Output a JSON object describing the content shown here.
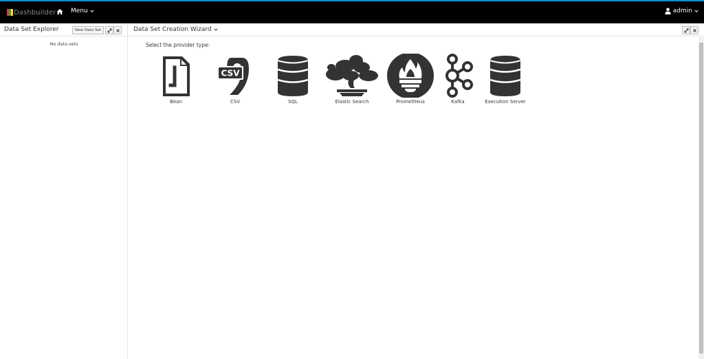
{
  "topbar": {
    "brand": "Dashbuilder",
    "menu_label": "Menu",
    "user_label": "admin",
    "accent": "#0b8fd4"
  },
  "left_panel": {
    "title": "Data Set Explorer",
    "new_button": "New Data Set",
    "empty_message": "No data sets"
  },
  "main_panel": {
    "title": "Data Set Creation Wizard",
    "prompt": "Select the provider type:",
    "providers": [
      {
        "label": "Bean",
        "icon": "java-bean-icon"
      },
      {
        "label": "CSV",
        "icon": "csv-file-icon"
      },
      {
        "label": "SQL",
        "icon": "database-icon"
      },
      {
        "label": "Elastic Search",
        "icon": "bonsai-tree-icon"
      },
      {
        "label": "Prometheus",
        "icon": "prometheus-torch-icon"
      },
      {
        "label": "Kafka",
        "icon": "kafka-icon"
      },
      {
        "label": "Execution Server",
        "icon": "database-icon"
      }
    ]
  }
}
